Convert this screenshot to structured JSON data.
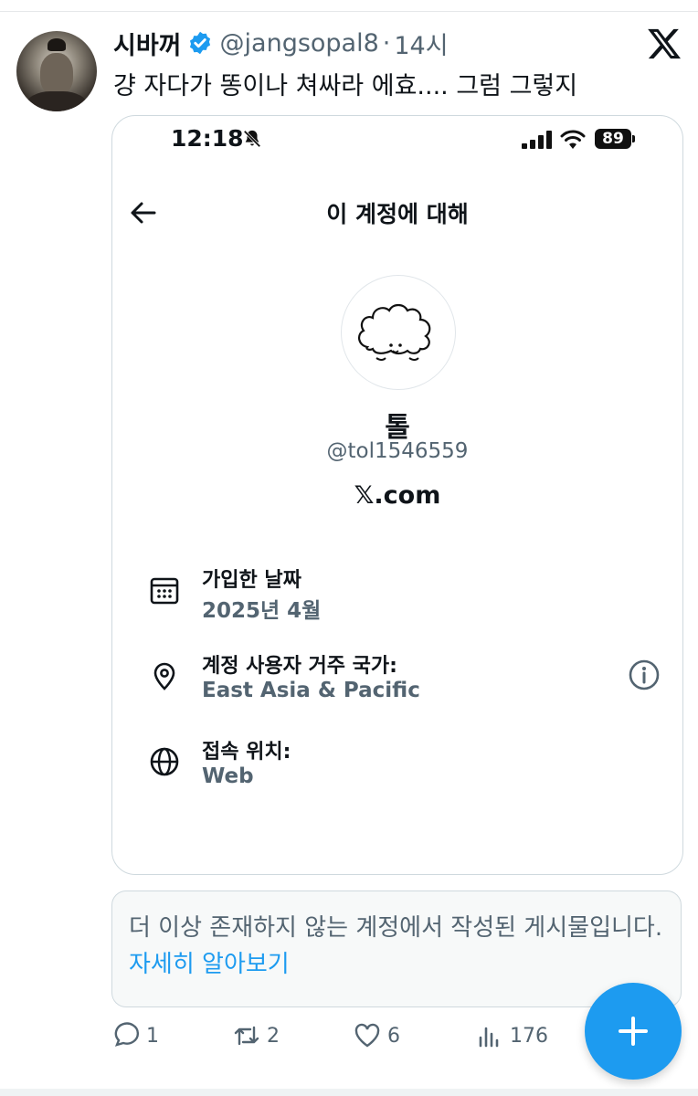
{
  "tweet": {
    "display_name": "시바꺼",
    "handle": "@jangsopal8",
    "separator": "·",
    "time": "14시",
    "text": "걍 자다가 똥이나 쳐싸라 에효.... 그럼 그렇지"
  },
  "screenshot": {
    "status_time": "12:18",
    "battery": "89",
    "title": "이 계정에 대해",
    "profile_name": "톨",
    "profile_handle": "@tol1546559",
    "profile_site": "𝕏.com",
    "rows": [
      {
        "label": "가입한 날짜",
        "value": "2025년 4월",
        "icon": "calendar-icon"
      },
      {
        "label": "계정 사용자 거주 국가:",
        "value": "East Asia & Pacific",
        "icon": "location-pin-icon"
      },
      {
        "label": "접속 위치:",
        "value": "Web",
        "icon": "globe-icon"
      }
    ]
  },
  "notice": {
    "text": "더 이상 존재하지 않는 계정에서 작성된 게시물입니다. ",
    "link": "자세히 알아보기"
  },
  "actions": {
    "reply_count": "1",
    "retweet_count": "2",
    "like_count": "6",
    "views_count": "176"
  },
  "colors": {
    "accent": "#1d9bf0",
    "muted_text": "#536471",
    "text": "#0f1419"
  }
}
